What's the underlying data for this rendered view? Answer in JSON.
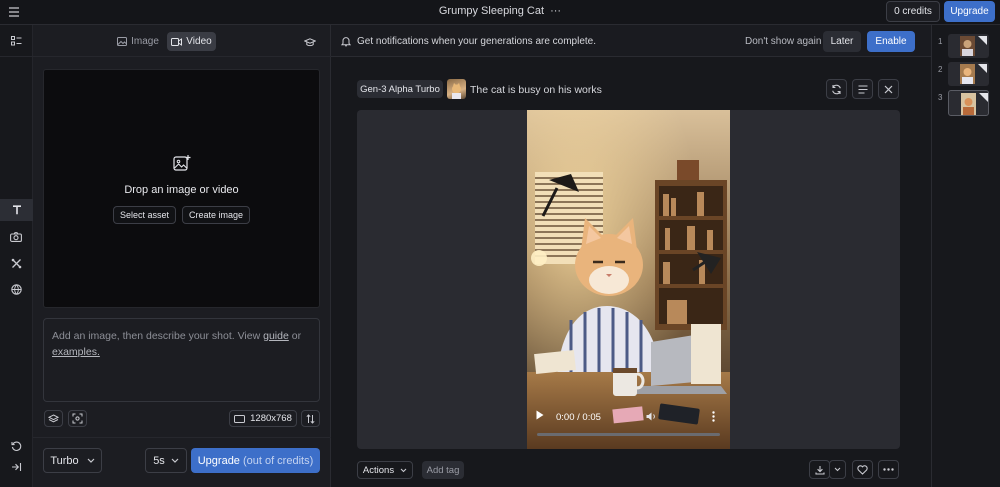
{
  "topbar": {
    "title": "Grumpy Sleeping Cat",
    "title_more": "···",
    "credits": "0 credits",
    "upgrade": "Upgrade"
  },
  "mode_tabs": {
    "image": "Image",
    "video": "Video"
  },
  "notification": {
    "text": "Get notifications when your generations are complete.",
    "dont_show": "Don't show again",
    "later": "Later",
    "enable": "Enable"
  },
  "dropzone": {
    "title": "Drop an image or video",
    "select_asset": "Select asset",
    "create_image": "Create image"
  },
  "prompt": {
    "text_before": "Add an image, then describe your shot. View ",
    "guide": "guide",
    "text_mid": " or ",
    "examples": "examples."
  },
  "resolution": "1280x768",
  "model_select": "Turbo",
  "duration_select": "5s",
  "generate_button": {
    "label": "Upgrade",
    "suffix": "(out of credits)"
  },
  "generation": {
    "model_badge": "Gen-3 Alpha Turbo",
    "prompt": "The cat is busy on his works",
    "video_time": "0:00 / 0:05"
  },
  "bottom_actions": {
    "actions": "Actions",
    "add_tag": "Add tag"
  },
  "history": [
    {
      "index": "1"
    },
    {
      "index": "2"
    },
    {
      "index": "3"
    }
  ],
  "icons": [
    "menu-icon",
    "layout-icon",
    "text-icon",
    "camera-icon",
    "tools-icon",
    "globe-icon",
    "history-icon",
    "collapse-icon",
    "bell-icon",
    "image-plus-icon",
    "refresh-icon",
    "lines-icon",
    "close-icon",
    "download-icon",
    "heart-icon",
    "more-icon"
  ],
  "colors": {
    "accent": "#3d6fc9",
    "background": "#17181c",
    "panel": "#1c1d22",
    "stage": "#2a2b31"
  }
}
